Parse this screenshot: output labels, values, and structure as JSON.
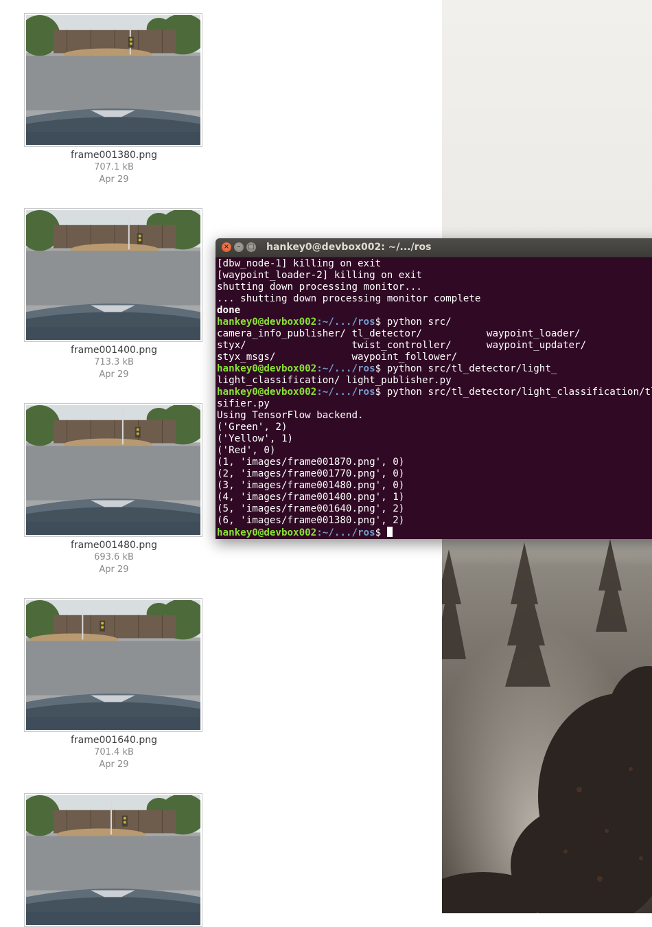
{
  "files": [
    {
      "name": "frame001380.png",
      "size": "707.1 kB",
      "date": "Apr 29"
    },
    {
      "name": "frame001400.png",
      "size": "713.3 kB",
      "date": "Apr 29"
    },
    {
      "name": "frame001480.png",
      "size": "693.6 kB",
      "date": "Apr 29"
    },
    {
      "name": "frame001640.png",
      "size": "701.4 kB",
      "date": "Apr 29"
    },
    {
      "name": "",
      "size": "",
      "date": ""
    }
  ],
  "terminal": {
    "title": "hankey0@devbox002: ~/.../ros",
    "prompt_user": "hankey0@devbox002",
    "prompt_path": ":~/.../ros",
    "lines": [
      {
        "type": "text",
        "text": "[dbw_node-1] killing on exit"
      },
      {
        "type": "text",
        "text": "[waypoint_loader-2] killing on exit"
      },
      {
        "type": "text",
        "text": "shutting down processing monitor..."
      },
      {
        "type": "text",
        "text": "... shutting down processing monitor complete"
      },
      {
        "type": "bold",
        "text": "done"
      },
      {
        "type": "prompt",
        "cmd": "$ python src/"
      },
      {
        "type": "text",
        "text": "camera_info_publisher/ tl_detector/           waypoint_loader/"
      },
      {
        "type": "text",
        "text": "styx/                  twist_controller/      waypoint_updater/"
      },
      {
        "type": "text",
        "text": "styx_msgs/             waypoint_follower/"
      },
      {
        "type": "prompt",
        "cmd": "$ python src/tl_detector/light_"
      },
      {
        "type": "text",
        "text": "light_classification/ light_publisher.py"
      },
      {
        "type": "prompt",
        "cmd": "$ python src/tl_detector/light_classification/tl_clas"
      },
      {
        "type": "text",
        "text": "sifier.py"
      },
      {
        "type": "text",
        "text": "Using TensorFlow backend."
      },
      {
        "type": "text",
        "text": "('Green', 2)"
      },
      {
        "type": "text",
        "text": "('Yellow', 1)"
      },
      {
        "type": "text",
        "text": "('Red', 0)"
      },
      {
        "type": "text",
        "text": "(1, 'images/frame001870.png', 0)"
      },
      {
        "type": "text",
        "text": "(2, 'images/frame001770.png', 0)"
      },
      {
        "type": "text",
        "text": "(3, 'images/frame001480.png', 0)"
      },
      {
        "type": "text",
        "text": "(4, 'images/frame001400.png', 1)"
      },
      {
        "type": "text",
        "text": "(5, 'images/frame001640.png', 2)"
      },
      {
        "type": "text",
        "text": "(6, 'images/frame001380.png', 2)"
      },
      {
        "type": "prompt",
        "cmd": "$ ",
        "cursor": true
      }
    ]
  },
  "colors": {
    "terminal_bg": "#300a24",
    "prompt_user": "#8ae234",
    "prompt_path": "#729fcf",
    "titlebar": "#3c3b37"
  },
  "icons": {
    "close": "close-icon",
    "minimize": "minimize-icon",
    "maximize": "maximize-icon"
  }
}
